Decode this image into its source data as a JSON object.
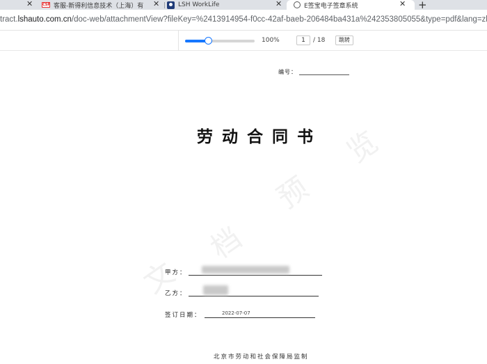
{
  "browser": {
    "tabs": [
      {
        "title": "客服-新得利信息技术（上海）有",
        "icon": "csp-favicon"
      },
      {
        "title": "LSH WorkLife",
        "icon": "lsh-favicon"
      },
      {
        "title": "E签宝电子签章系统",
        "icon": "globe-icon",
        "active": true
      }
    ],
    "url_prefix": "tract.",
    "url_host": "lshauto.com.cn",
    "url_path": "/doc-web/attachmentView?fileKey=%2413914954-f0cc-42af-baeb-206484ba431a%242353805055&type=pdf&lang=zh"
  },
  "pdf_toolbar": {
    "zoom_fraction": 0.33,
    "zoom_label": "100%",
    "current_page": "1",
    "total_pages": "/ 18",
    "jump_label": "跳转"
  },
  "document": {
    "number_label": "编号：",
    "title": "劳动合同书",
    "party_a_label": "甲方：",
    "party_b_label": "乙方：",
    "sign_date_label": "签订日期：",
    "sign_date_value": "2022-07-07",
    "footer": "北京市劳动和社会保障局监制",
    "watermark": [
      "文",
      "档",
      "预",
      "览"
    ]
  }
}
